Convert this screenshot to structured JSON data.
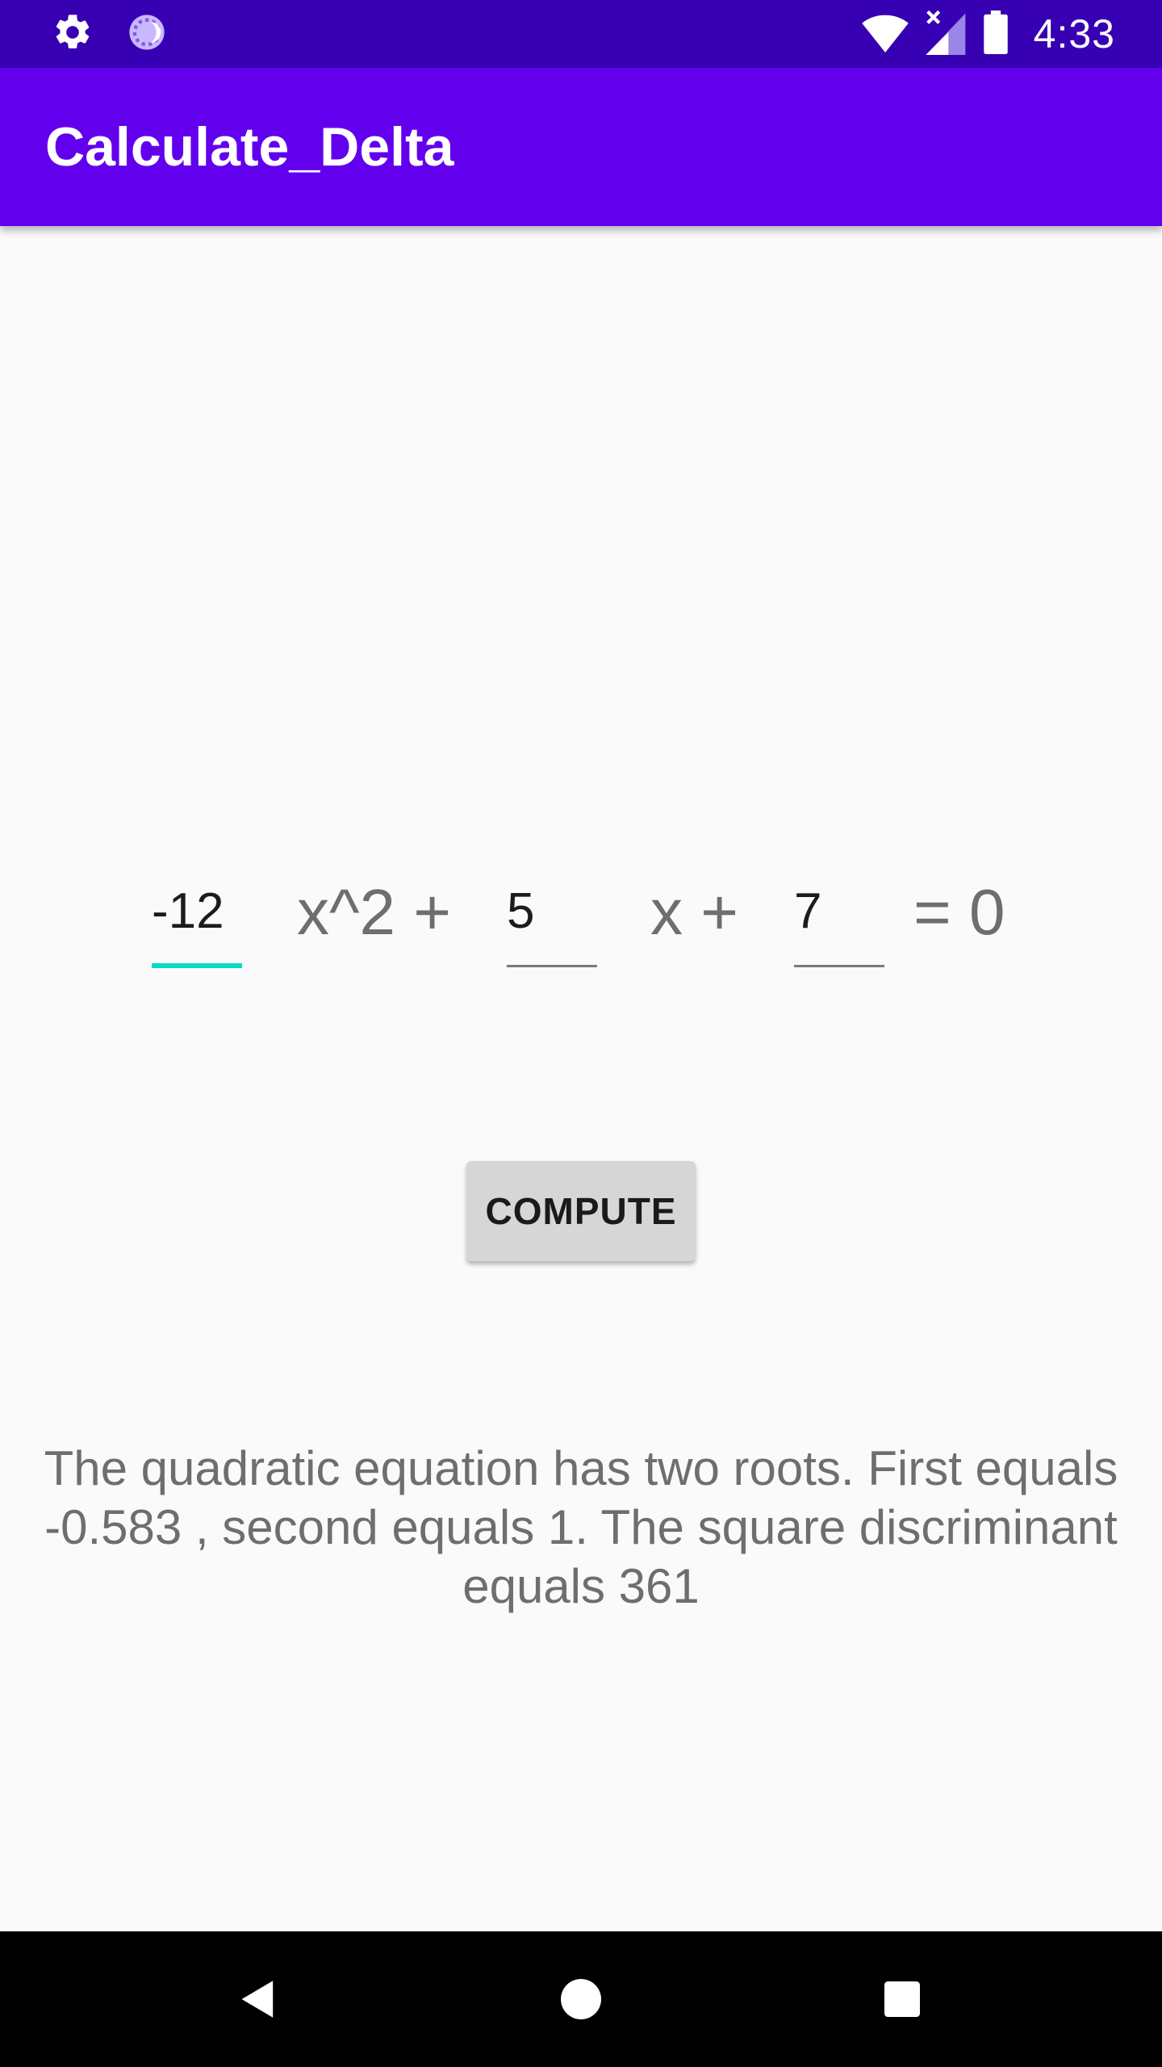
{
  "status_bar": {
    "time": "4:33",
    "icons": [
      "settings-icon",
      "sync-icon",
      "wifi-icon",
      "signal-icon",
      "battery-icon"
    ]
  },
  "app_bar": {
    "title": "Calculate_Delta"
  },
  "equation": {
    "a_value": "-12",
    "b_value": "5",
    "c_value": "7",
    "term_a": "x^2 +",
    "term_b": "x +",
    "term_c": "= 0"
  },
  "compute_button": {
    "label": "COMPUTE"
  },
  "result": {
    "text": "The quadratic equation has two roots. First equals -0.583 , second equals 1. The square discriminant equals 361"
  },
  "nav_bar": {
    "icons": [
      "back-icon",
      "home-icon",
      "recents-icon"
    ]
  },
  "colors": {
    "status_bar": "#3700b3",
    "app_bar": "#6200ee",
    "accent": "#03dac5",
    "background": "#fafafa",
    "button": "#d6d6d6"
  }
}
